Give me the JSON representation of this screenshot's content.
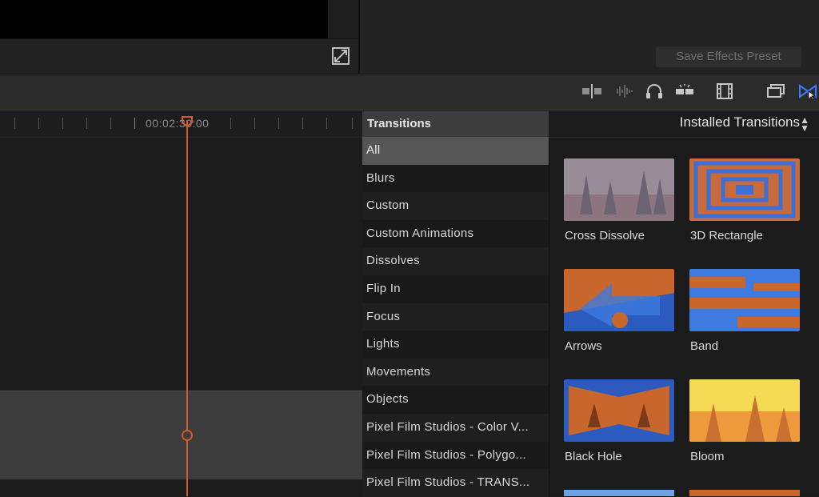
{
  "viewer": {
    "fullscreen_icon": "fullscreen-icon"
  },
  "inspector": {
    "save_preset_label": "Save Effects Preset"
  },
  "toolbar": {
    "icons": [
      "clip-split-icon",
      "audio-waveform-icon",
      "headphones-icon",
      "skimming-icon",
      "filmstrip-icon",
      "effects-browser-icon",
      "transitions-browser-icon"
    ]
  },
  "timeline": {
    "timecode": "00:02:30:00",
    "playhead_color": "#d35a2d"
  },
  "categories": {
    "header": "Transitions",
    "items": [
      "All",
      "Blurs",
      "Custom",
      "Custom Animations",
      "Dissolves",
      "Flip In",
      "Focus",
      "Lights",
      "Movements",
      "Objects",
      "Pixel Film Studios - Color V...",
      "Pixel Film Studios - Polygo...",
      "Pixel Film Studios - TRANS..."
    ],
    "selected": "All"
  },
  "browser": {
    "filter_label": "Installed Transitions",
    "transitions": [
      "Cross Dissolve",
      "3D Rectangle",
      "Arrows",
      "Band",
      "Black Hole",
      "Bloom"
    ]
  }
}
